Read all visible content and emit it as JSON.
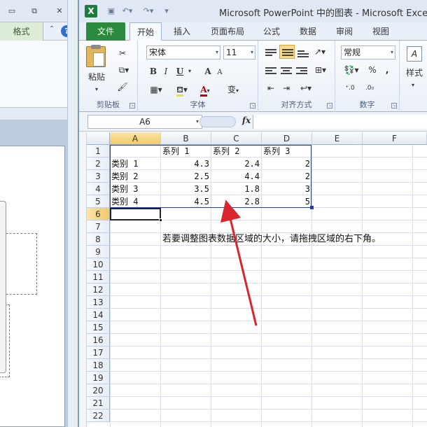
{
  "powerpoint": {
    "tab_format": "格式"
  },
  "excel": {
    "title": "Microsoft PowerPoint 中的图表 - Microsoft Excel",
    "tabs": [
      "文件",
      "开始",
      "插入",
      "页面布局",
      "公式",
      "数据",
      "审阅",
      "视图"
    ],
    "active_tab": "开始",
    "ribbon": {
      "clipboard": {
        "paste": "粘贴",
        "label": "剪贴板"
      },
      "font": {
        "name": "宋体",
        "size": "11",
        "label": "字体",
        "bold": "B",
        "italic": "I",
        "underline": "U",
        "grow": "A",
        "shrink": "A",
        "color_a": "A",
        "wen": "变"
      },
      "alignment": {
        "label": "对齐方式"
      },
      "number": {
        "format": "常规",
        "label": "数字",
        "percent": "%",
        "comma": ","
      },
      "styles": {
        "label": "样式"
      }
    },
    "name_box": "A6",
    "fx": "fx",
    "columns": [
      "A",
      "B",
      "C",
      "D",
      "E",
      "F"
    ],
    "selected_column": "A",
    "selected_row": 6,
    "rows": [
      [
        "",
        "系列 1",
        "系列 2",
        "系列 3"
      ],
      [
        "类别 1",
        "4.3",
        "2.4",
        "2"
      ],
      [
        "类别 2",
        "2.5",
        "4.4",
        "2"
      ],
      [
        "类别 3",
        "3.5",
        "1.8",
        "3"
      ],
      [
        "类别 4",
        "4.5",
        "2.8",
        "5"
      ]
    ],
    "row_numbers": [
      "1",
      "2",
      "3",
      "4",
      "5",
      "6",
      "7",
      "8",
      "9",
      "10",
      "11",
      "12",
      "13",
      "14",
      "15",
      "16",
      "17",
      "18",
      "19",
      "20",
      "21",
      "22"
    ],
    "note": "若要调整图表数据区域的大小，请拖拽区域的右下角。"
  },
  "colors": {
    "file_tab": "#2b8a3e",
    "selection_header": "#f3c965",
    "data_range_border": "#2d3f9c",
    "arrow": "#d9262d"
  }
}
